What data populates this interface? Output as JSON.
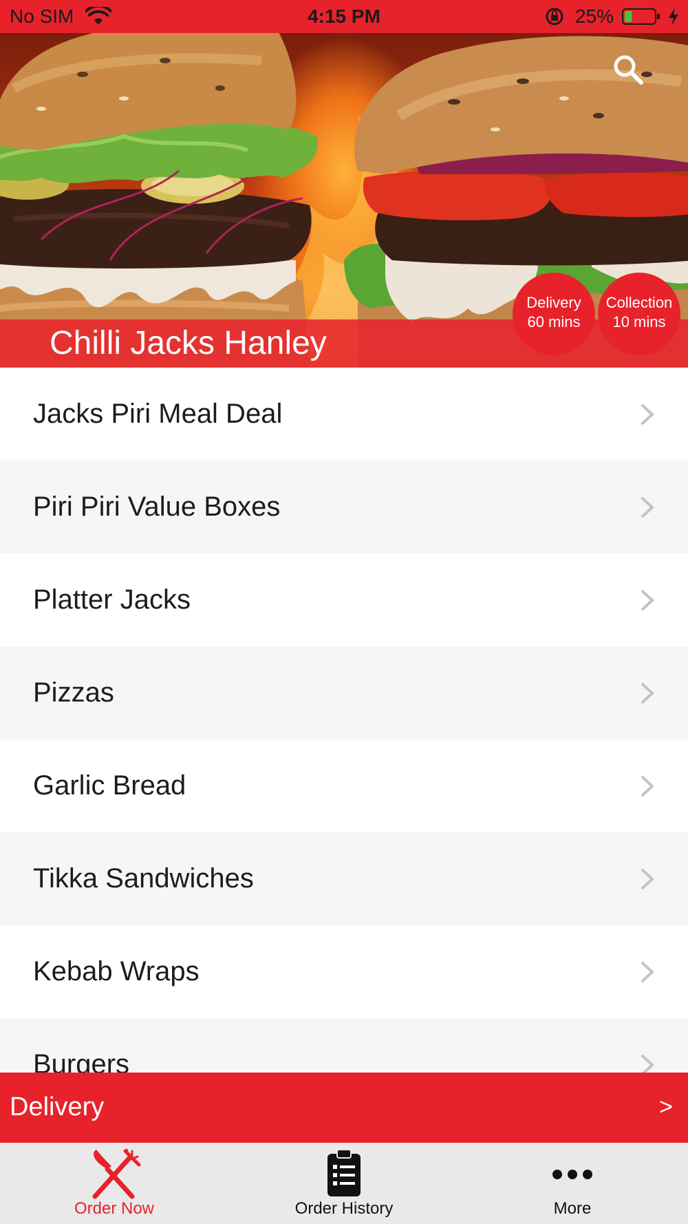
{
  "status_bar": {
    "carrier": "No SIM",
    "time": "4:15 PM",
    "battery": "25%",
    "battery_level": 0.25
  },
  "hero": {
    "title": "Chilli Jacks Hanley",
    "delivery_badge": {
      "line1": "Delivery",
      "line2": "60 mins"
    },
    "collection_badge": {
      "line1": "Collection",
      "line2": "10 mins"
    },
    "search_icon": "search-icon"
  },
  "menu": {
    "items": [
      {
        "label": "Jacks Piri Meal Deal"
      },
      {
        "label": "Piri Piri Value Boxes"
      },
      {
        "label": "Platter Jacks"
      },
      {
        "label": "Pizzas"
      },
      {
        "label": "Garlic Bread"
      },
      {
        "label": "Tikka Sandwiches"
      },
      {
        "label": "Kebab Wraps"
      },
      {
        "label": "Burgers"
      }
    ]
  },
  "delivery_bar": {
    "label": "Delivery",
    "arrow": ">"
  },
  "tabs": [
    {
      "label": "Order Now",
      "icon": "fork-knife-icon",
      "active": true
    },
    {
      "label": "Order History",
      "icon": "clipboard-list-icon",
      "active": false
    },
    {
      "label": "More",
      "icon": "more-dots-icon",
      "active": false
    }
  ],
  "colors": {
    "accent": "#e8222b",
    "tab_bar_bg": "#e9e9e9",
    "row_alt": "#f6f6f6"
  }
}
